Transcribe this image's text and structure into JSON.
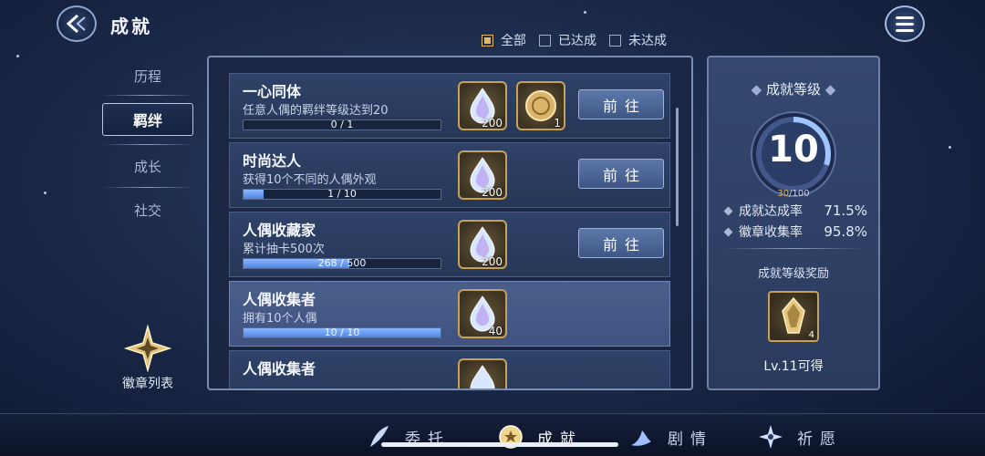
{
  "header": {
    "title": "成就"
  },
  "filters": [
    {
      "label": "全部",
      "checked": true
    },
    {
      "label": "已达成",
      "checked": false
    },
    {
      "label": "未达成",
      "checked": false
    }
  ],
  "left_nav": {
    "items": [
      "历程",
      "羁绊",
      "成长",
      "社交"
    ],
    "active": "羁绊",
    "badge_list_label": "徽章列表"
  },
  "achievements": [
    {
      "title": "一心同体",
      "desc": "任意人偶的羁绊等级达到20",
      "progress_text": "0 / 1",
      "progress": 0.0,
      "rewards": [
        {
          "icon": "crystal-drop-icon",
          "count": "200"
        },
        {
          "icon": "gold-coin-icon",
          "count": "1"
        }
      ],
      "button": "前往"
    },
    {
      "title": "时尚达人",
      "desc": "获得10个不同的人偶外观",
      "progress_text": "1 / 10",
      "progress": 0.1,
      "rewards": [
        {
          "icon": "crystal-drop-icon",
          "count": "200"
        }
      ],
      "button": "前往"
    },
    {
      "title": "人偶收藏家",
      "desc": "累计抽卡500次",
      "progress_text": "268 / 500",
      "progress": 0.536,
      "rewards": [
        {
          "icon": "crystal-drop-icon",
          "count": "200"
        }
      ],
      "button": "前往"
    },
    {
      "title": "人偶收集者",
      "desc": "拥有10个人偶",
      "progress_text": "10 / 10",
      "progress": 1.0,
      "rewards": [
        {
          "icon": "crystal-drop-icon",
          "count": "40"
        }
      ],
      "button": ""
    },
    {
      "title": "人偶收集者",
      "desc": "",
      "progress_text": "",
      "progress": 0,
      "rewards": [
        {
          "icon": "crystal-drop-icon",
          "count": ""
        }
      ],
      "button": ""
    }
  ],
  "level_panel": {
    "title": "成就等级",
    "level": "10",
    "exp_current": "30",
    "exp_max": "/100",
    "exp_fraction": 0.3,
    "stats": [
      {
        "label": "成就达成率",
        "value": "71.5%"
      },
      {
        "label": "徽章收集率",
        "value": "95.8%"
      }
    ],
    "reward_title": "成就等级奖励",
    "reward_count": "4",
    "reward_label": "Lv.11可得"
  },
  "bottom_tabs": [
    {
      "label": "委托",
      "icon": "feather-icon",
      "active": false
    },
    {
      "label": "成就",
      "icon": "medal-icon",
      "active": true
    },
    {
      "label": "剧情",
      "icon": "quill-wave-icon",
      "active": false
    },
    {
      "label": "祈愿",
      "icon": "sparkle-star-icon",
      "active": false
    }
  ],
  "colors": {
    "accent_gold": "#e4b55a",
    "progress_blue": "#6aa0f5"
  }
}
